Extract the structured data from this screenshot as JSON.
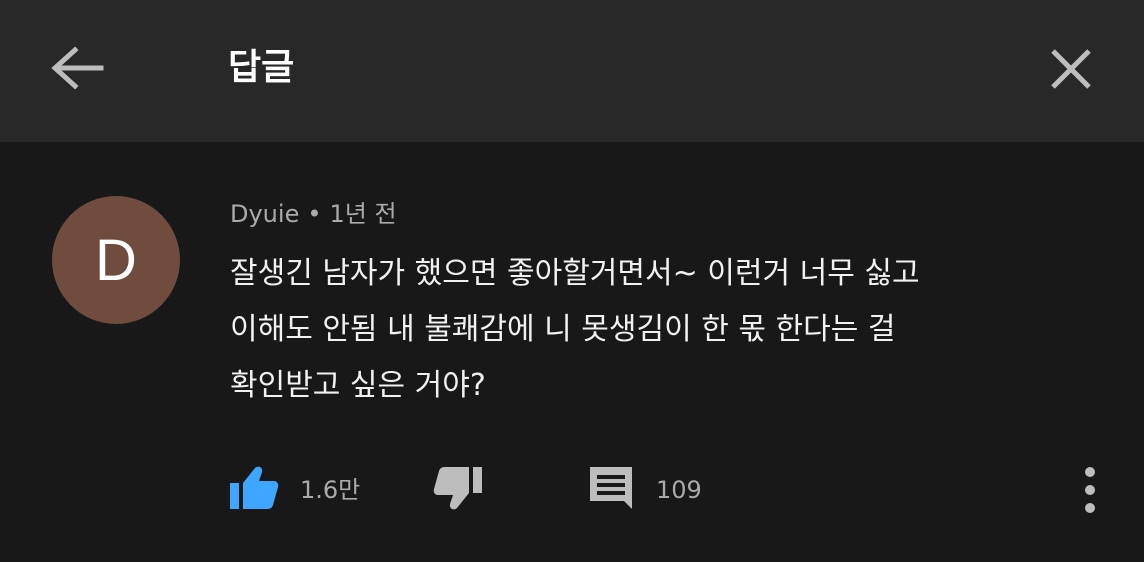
{
  "header": {
    "title": "답글"
  },
  "comment": {
    "avatar_letter": "D",
    "avatar_color": "#6f4c3e",
    "author": "Dyuie",
    "separator": "•",
    "time": "1년 전",
    "lines": [
      "잘생긴 남자가 했으면 좋아할거면서~ 이런거 너무 싫고",
      "이해도 안됨 내 불쾌감에 니 못생김이 한 몫 한다는 걸",
      "확인받고 싶은 거야?"
    ],
    "like_count": "1.6만",
    "reply_count": "109"
  },
  "icons": {
    "back": "arrow-left-icon",
    "close": "close-icon",
    "like": "thumbs-up-icon",
    "dislike": "thumbs-down-icon",
    "reply": "comment-icon",
    "more": "more-vertical-icon"
  },
  "colors": {
    "header_bg": "#282828",
    "body_bg": "#181818",
    "like_active": "#3ea6ff",
    "secondary_text": "#aaaaaa"
  }
}
